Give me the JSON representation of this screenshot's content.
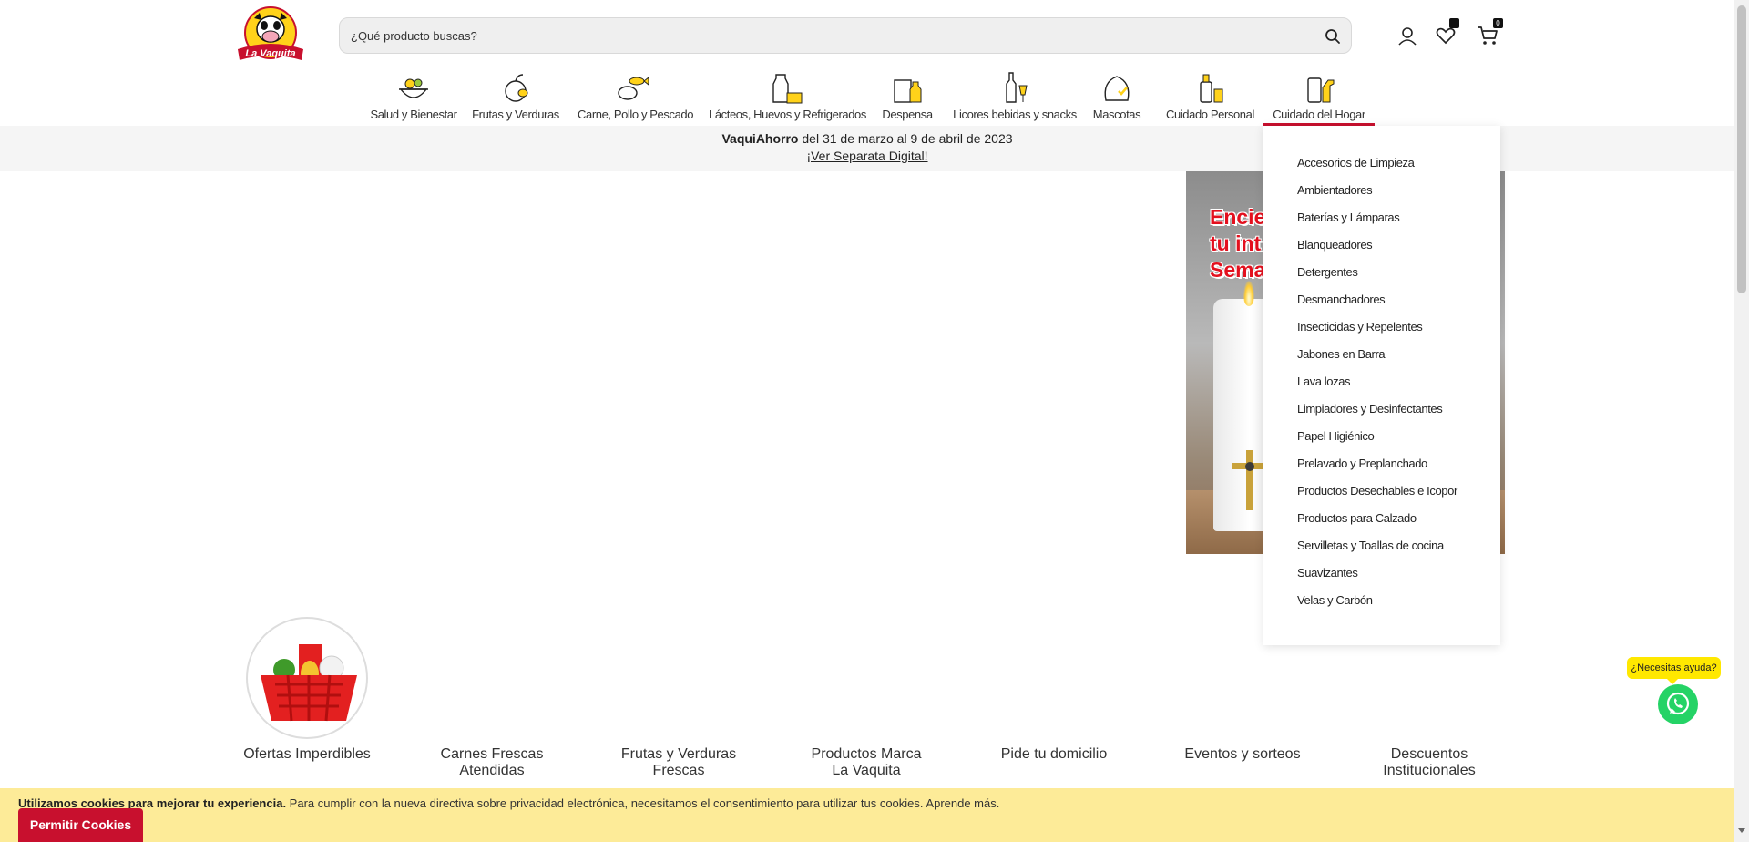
{
  "brand": {
    "logo_text": "La Vaquita",
    "color": "#c8102e"
  },
  "search": {
    "placeholder": "¿Qué producto buscas?"
  },
  "header": {
    "wishlist_count": "",
    "cart_count": "0"
  },
  "categories": [
    {
      "label": "Salud y Bienestar",
      "icon": "salad-bowl-icon"
    },
    {
      "label": "Frutas y Verduras",
      "icon": "fruit-basket-icon"
    },
    {
      "label": "Carne, Pollo y Pescado",
      "icon": "meat-fish-icon"
    },
    {
      "label": "Lácteos, Huevos y Refrigerados",
      "icon": "milk-cheese-icon"
    },
    {
      "label": "Despensa",
      "icon": "pantry-icon"
    },
    {
      "label": "Licores bebidas y snacks",
      "icon": "bottle-glass-icon"
    },
    {
      "label": "Mascotas",
      "icon": "pet-icon"
    },
    {
      "label": "Cuidado Personal",
      "icon": "personal-care-icon"
    },
    {
      "label": "Cuidado del Hogar",
      "icon": "home-cleaning-icon"
    }
  ],
  "promo": {
    "brand": "VaquiAhorro",
    "dates": " del 31 de marzo al 9 de abril de 2023",
    "link": "¡Ver Separata Digital!"
  },
  "banner": {
    "line1": "Encie",
    "line2": "tu int",
    "line3": "Sema"
  },
  "dropdown": {
    "items": [
      "Accesorios de Limpieza",
      "Ambientadores",
      "Baterías y Lámparas",
      "Blanqueadores",
      "Detergentes",
      "Desmanchadores",
      "Insecticidas y Repelentes",
      "Jabones en Barra",
      "Lava lozas",
      "Limpiadores y Desinfectantes",
      "Papel Higiénico",
      "Prelavado y Preplanchado",
      "Productos Desechables e Icopor",
      "Productos para Calzado",
      "Servilletas y Toallas de cocina",
      "Suavizantes",
      "Velas y Carbón"
    ]
  },
  "lower_nav": [
    {
      "line1": "Ofertas Imperdibles",
      "line2": ""
    },
    {
      "line1": "Carnes Frescas",
      "line2": "Atendidas"
    },
    {
      "line1": "Frutas y Verduras",
      "line2": "Frescas"
    },
    {
      "line1": "Productos Marca",
      "line2": "La Vaquita"
    },
    {
      "line1": "Pide tu domicilio",
      "line2": ""
    },
    {
      "line1": "Eventos y sorteos",
      "line2": ""
    },
    {
      "line1": "Descuentos",
      "line2": "Institucionales"
    }
  ],
  "help": {
    "label": "¿Necesitas ayuda?"
  },
  "cookie": {
    "bold": "Utilizamos cookies para mejorar tu experiencia.",
    "text": " Para cumplir con la nueva directiva sobre privacidad electrónica, necesitamos el consentimiento para utilizar tus cookies. ",
    "more": "Aprende más.",
    "button": "Permitir Cookies"
  }
}
